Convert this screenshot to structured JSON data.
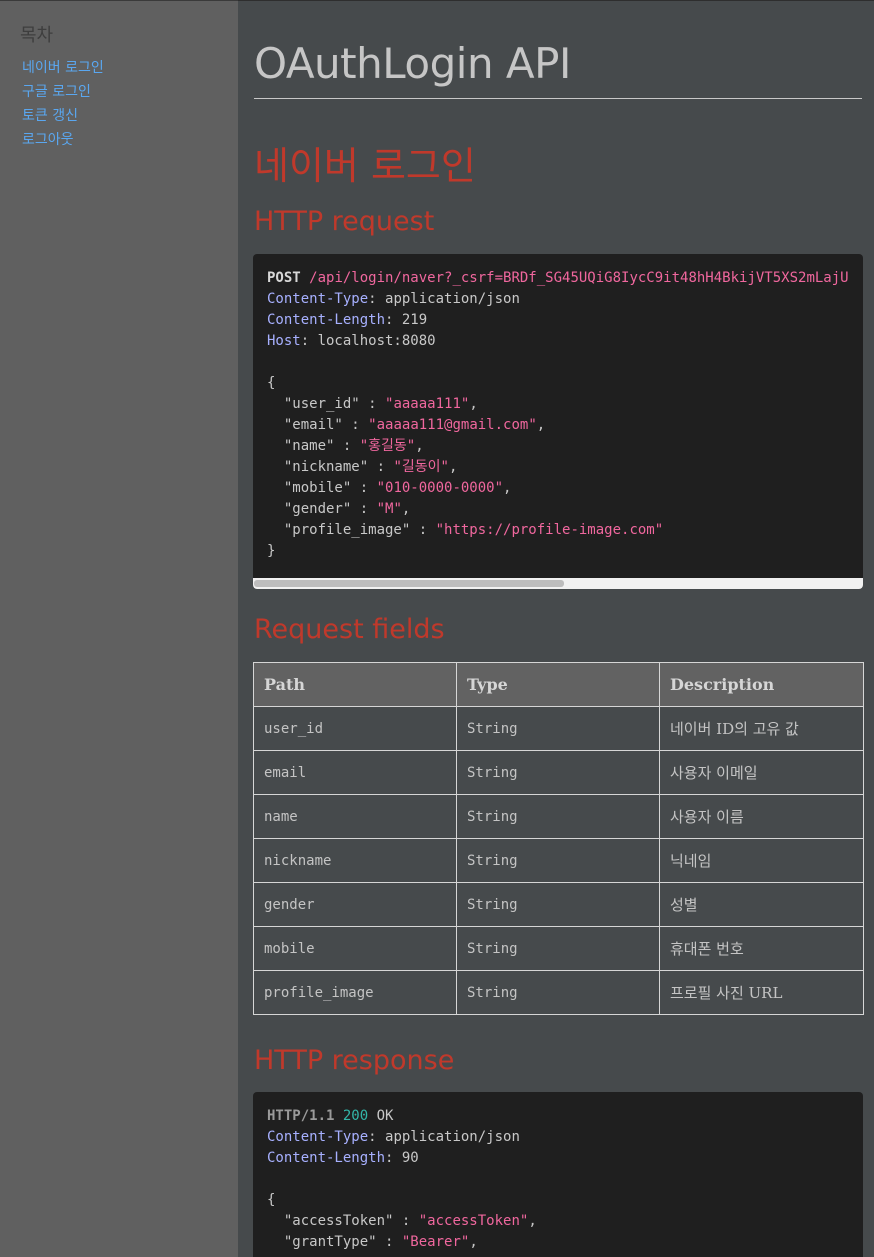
{
  "toc": {
    "title": "목차",
    "items": [
      "네이버 로그인",
      "구글 로그인",
      "토큰 갱신",
      "로그아웃"
    ]
  },
  "doc_title": "OAuthLogin API",
  "section_title": "네이버 로그인",
  "http_request": {
    "heading": "HTTP request",
    "method": "POST",
    "url": "/api/login/naver?_csrf=BRDf_SG45UQiG8IycC9it48hH4BkijVT5XS2mLajU",
    "headers": [
      {
        "name": "Content-Type",
        "value": "application/json"
      },
      {
        "name": "Content-Length",
        "value": "219"
      },
      {
        "name": "Host",
        "value": "localhost:8080"
      }
    ],
    "body": [
      {
        "key": "\"user_id\"",
        "value": "\"aaaaa111\"",
        "comma": ","
      },
      {
        "key": "\"email\"",
        "value": "\"aaaaa111@gmail.com\"",
        "comma": ","
      },
      {
        "key": "\"name\"",
        "value": "\"홍길동\"",
        "comma": ","
      },
      {
        "key": "\"nickname\"",
        "value": "\"길동이\"",
        "comma": ","
      },
      {
        "key": "\"mobile\"",
        "value": "\"010-0000-0000\"",
        "comma": ","
      },
      {
        "key": "\"gender\"",
        "value": "\"M\"",
        "comma": ","
      },
      {
        "key": "\"profile_image\"",
        "value": "\"https://profile-image.com\"",
        "comma": ""
      }
    ],
    "scroll_position": 0.0
  },
  "request_fields": {
    "heading": "Request fields",
    "columns": [
      "Path",
      "Type",
      "Description"
    ],
    "rows": [
      [
        "user_id",
        "String",
        "네이버 ID의 고유 값"
      ],
      [
        "email",
        "String",
        "사용자 이메일"
      ],
      [
        "name",
        "String",
        "사용자 이름"
      ],
      [
        "nickname",
        "String",
        "닉네임"
      ],
      [
        "gender",
        "String",
        "성별"
      ],
      [
        "mobile",
        "String",
        "휴대폰 번호"
      ],
      [
        "profile_image",
        "String",
        "프로필 사진 URL"
      ]
    ]
  },
  "http_response": {
    "heading": "HTTP response",
    "protocol": "HTTP/1.1",
    "status_code": "200",
    "status_text": "OK",
    "headers": [
      {
        "name": "Content-Type",
        "value": "application/json"
      },
      {
        "name": "Content-Length",
        "value": "90"
      }
    ],
    "body": [
      {
        "key": "\"accessToken\"",
        "value": "\"accessToken\"",
        "comma": ","
      },
      {
        "key": "\"grantType\"",
        "value": "\"Bearer\"",
        "comma": ","
      }
    ]
  },
  "colors": {
    "heading": "#c0392b",
    "link": "#5aa7f0",
    "string": "#f0679e",
    "header_name": "#a7b0ff",
    "status_code": "#33b5a8"
  }
}
